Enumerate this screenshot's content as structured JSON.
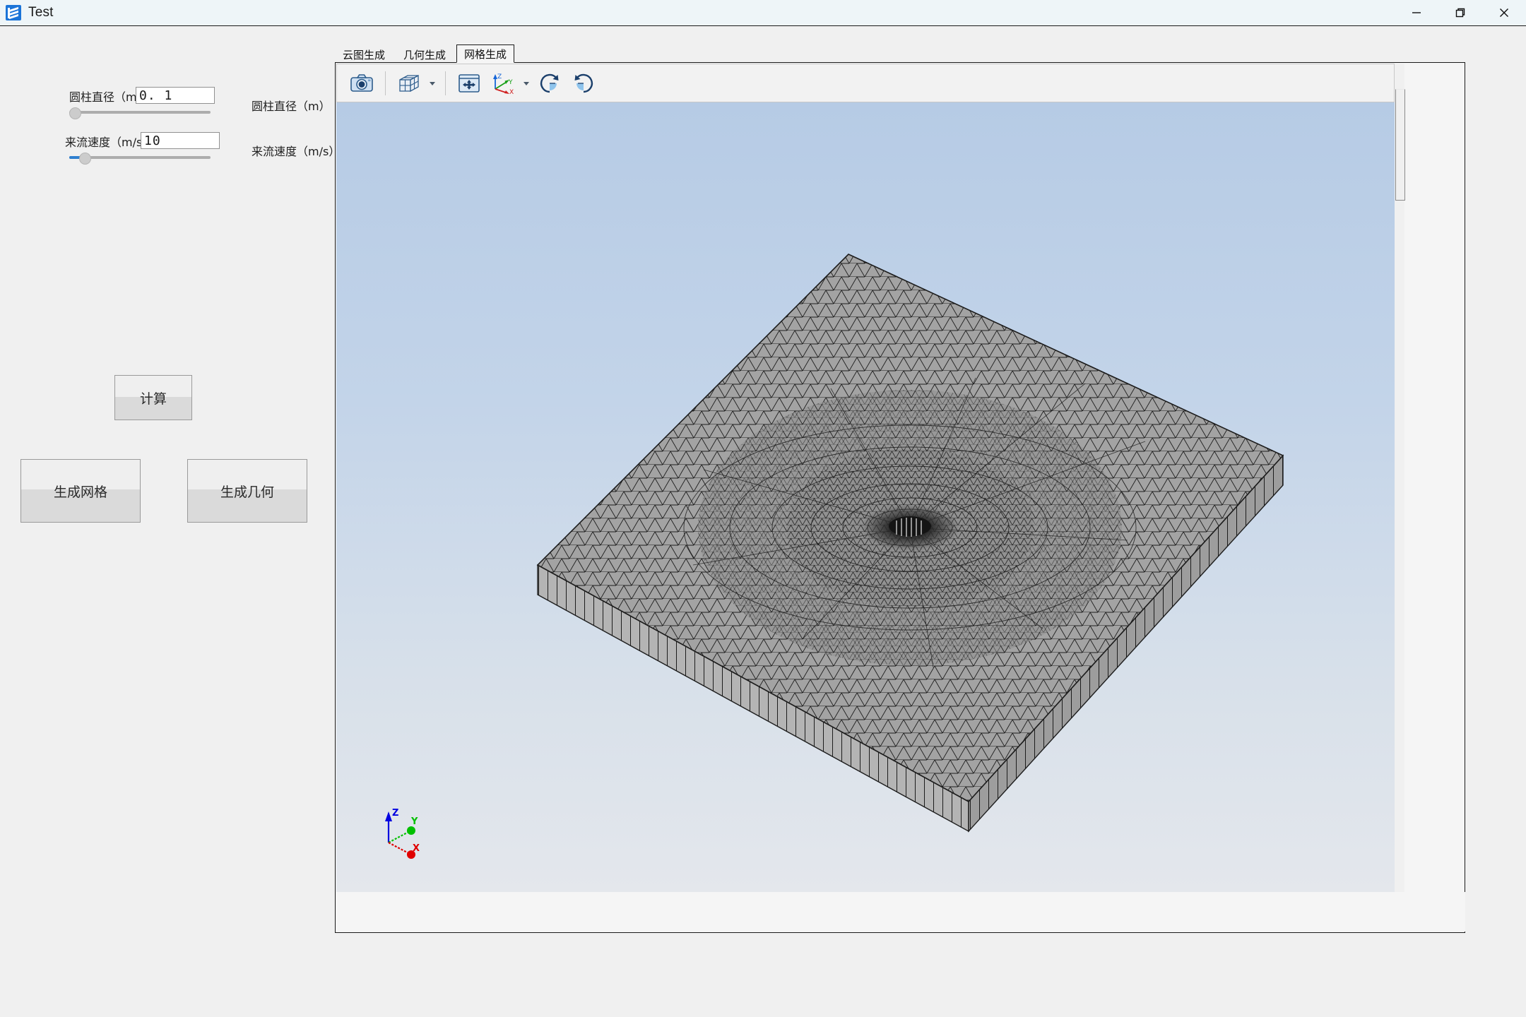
{
  "window": {
    "title": "Test",
    "app_icon": "book-stack-icon",
    "controls": {
      "minimize": "minimize-icon",
      "restore": "restore-icon",
      "close": "close-icon"
    }
  },
  "left_panel": {
    "params": [
      {
        "label": "圆柱直径（m）",
        "value": "0. 1",
        "slider_percent": 0,
        "side_label": "圆柱直径（m）"
      },
      {
        "label": "来流速度（m/s）",
        "value": "10",
        "slider_percent": 8,
        "side_label": "来流速度（m/s）"
      }
    ],
    "buttons": [
      {
        "label": "计算",
        "name": "calculate-button"
      },
      {
        "label": "生成网格",
        "name": "generate-mesh-button"
      },
      {
        "label": "生成几何",
        "name": "generate-geometry-button"
      }
    ]
  },
  "tabs": [
    {
      "label": "云图生成",
      "active": false
    },
    {
      "label": "几何生成",
      "active": false
    },
    {
      "label": "网格生成",
      "active": true
    }
  ],
  "viewport_toolbar": [
    {
      "name": "screenshot-camera-icon",
      "has_caret": false
    },
    {
      "name": "view-cube-icon",
      "has_caret": true
    },
    {
      "name": "fit-to-view-icon",
      "has_caret": false
    },
    {
      "name": "orientation-axes-icon",
      "has_caret": true
    },
    {
      "name": "rotate-clockwise-icon",
      "has_caret": false
    },
    {
      "name": "rotate-counterclockwise-icon",
      "has_caret": false
    }
  ],
  "viewport": {
    "axis_labels": {
      "x": "X",
      "y": "Y",
      "z": "Z"
    },
    "axis_colors": {
      "x": "#e00000",
      "y": "#00c000",
      "z": "#0000e0"
    },
    "background_top": "#b6cbe5",
    "background_bottom": "#e4e7ec",
    "mesh_fill": "#a0a0a0",
    "mesh_edge": "#1a1a1a",
    "model_description": "三角形网格平板，中心为圆柱孔"
  }
}
